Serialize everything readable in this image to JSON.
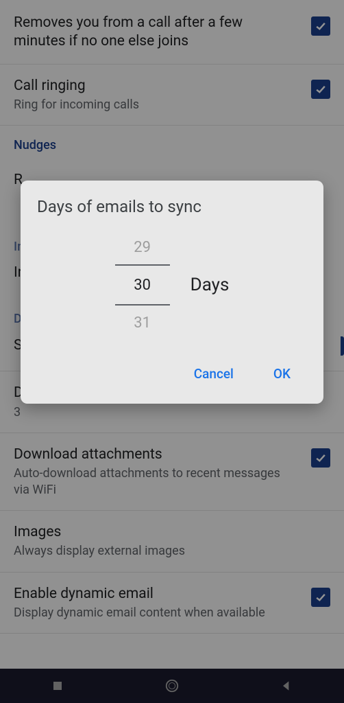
{
  "settings": {
    "item1": {
      "title": "",
      "subtitle": "Removes you from a call after a few minutes if no one else joins",
      "checked": true
    },
    "item2": {
      "title": "Call ringing",
      "subtitle": "Ring for incoming calls",
      "checked": true
    },
    "section1": "Nudges",
    "item3_partial": "R",
    "section2_partial": "In",
    "item4_partial": "Ir",
    "section3_partial": "D",
    "item5_partial": "S",
    "item6_title_partial": "D",
    "item6_subtitle_partial": "3",
    "item7": {
      "title": "Download attachments",
      "subtitle": "Auto-download attachments to recent messages via WiFi",
      "checked": true
    },
    "item8": {
      "title": "Images",
      "subtitle": "Always display external images"
    },
    "item9": {
      "title": "Enable dynamic email",
      "subtitle": "Display dynamic email content when available",
      "checked": true
    }
  },
  "dialog": {
    "title": "Days of emails to sync",
    "picker": {
      "prev": "29",
      "current": "30",
      "next": "31"
    },
    "unit": "Days",
    "cancel": "Cancel",
    "ok": "OK"
  }
}
